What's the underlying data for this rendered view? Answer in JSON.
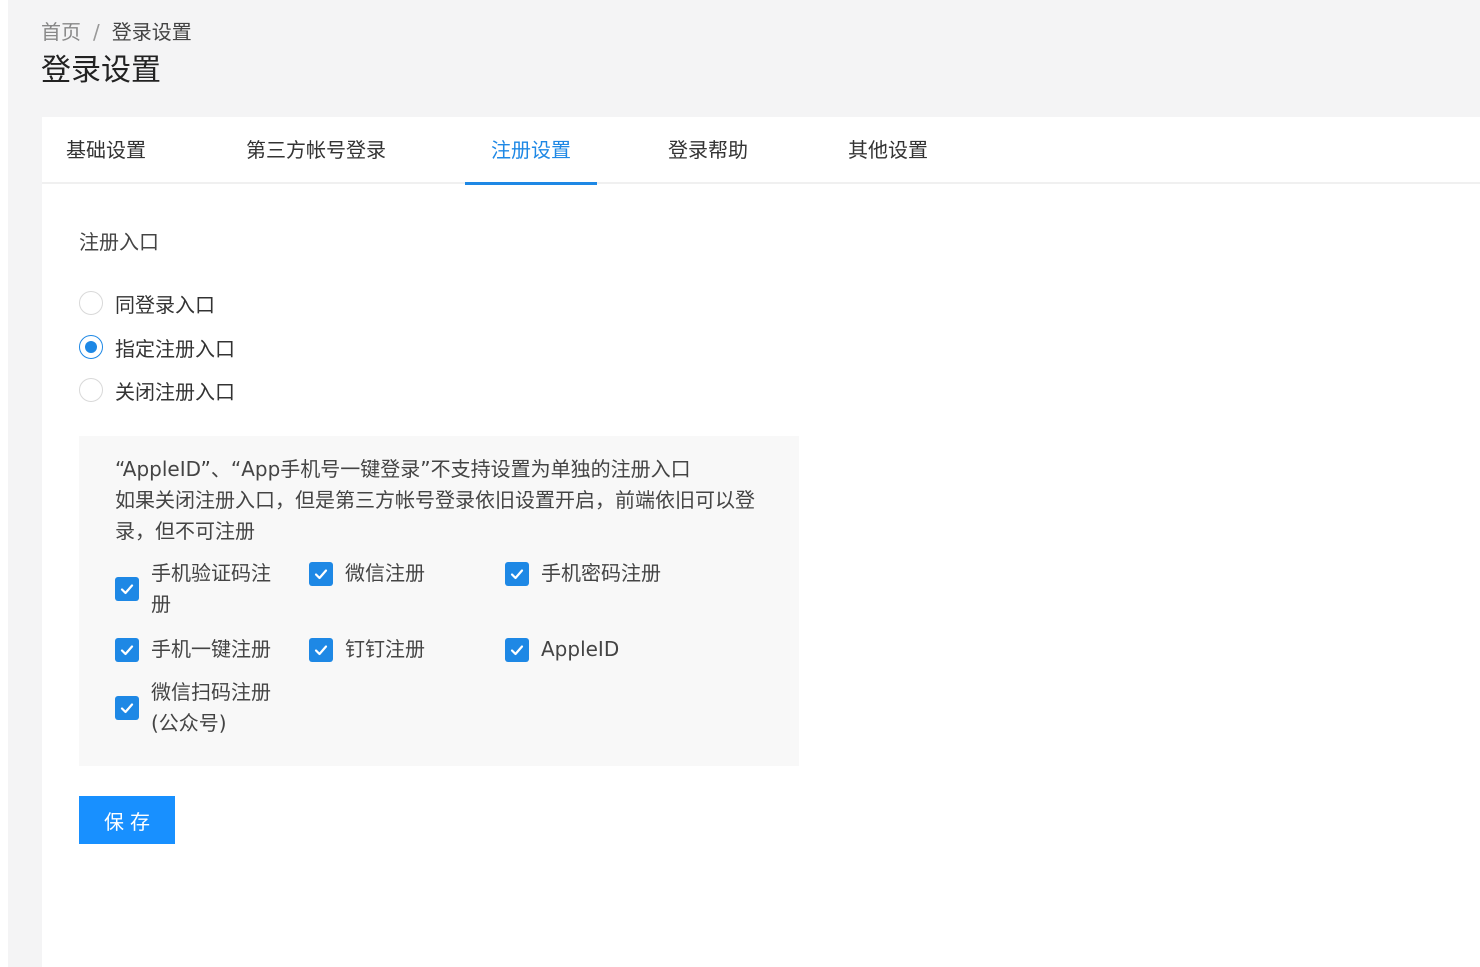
{
  "breadcrumb": {
    "home": "首页",
    "separator": "/",
    "current": "登录设置"
  },
  "page_title": "登录设置",
  "tabs": [
    {
      "label": "基础设置",
      "active": false
    },
    {
      "label": "第三方帐号登录",
      "active": false
    },
    {
      "label": "注册设置",
      "active": true
    },
    {
      "label": "登录帮助",
      "active": false
    },
    {
      "label": "其他设置",
      "active": false
    }
  ],
  "register_entry": {
    "label": "注册入口",
    "options": [
      {
        "label": "同登录入口",
        "checked": false
      },
      {
        "label": "指定注册入口",
        "checked": true
      },
      {
        "label": "关闭注册入口",
        "checked": false
      }
    ]
  },
  "notice": {
    "line1": "“AppleID”、“App手机号一键登录”不支持设置为单独的注册入口",
    "line2": "如果关闭注册入口，但是第三方帐号登录依旧设置开启，前端依旧可以登录，但不可注册"
  },
  "register_methods": [
    {
      "label": "手机验证码注册",
      "checked": true
    },
    {
      "label": "微信注册",
      "checked": true
    },
    {
      "label": "手机密码注册",
      "checked": true
    },
    {
      "label": "手机一键注册",
      "checked": true
    },
    {
      "label": "钉钉注册",
      "checked": true
    },
    {
      "label": "AppleID",
      "checked": true
    },
    {
      "label": "微信扫码注册(公众号)",
      "checked": true
    }
  ],
  "save_label": "保存",
  "colors": {
    "accent": "#1e88e5",
    "button": "#1890ff",
    "page_bg": "#f4f4f5",
    "info_bg": "#f8f8f8"
  }
}
